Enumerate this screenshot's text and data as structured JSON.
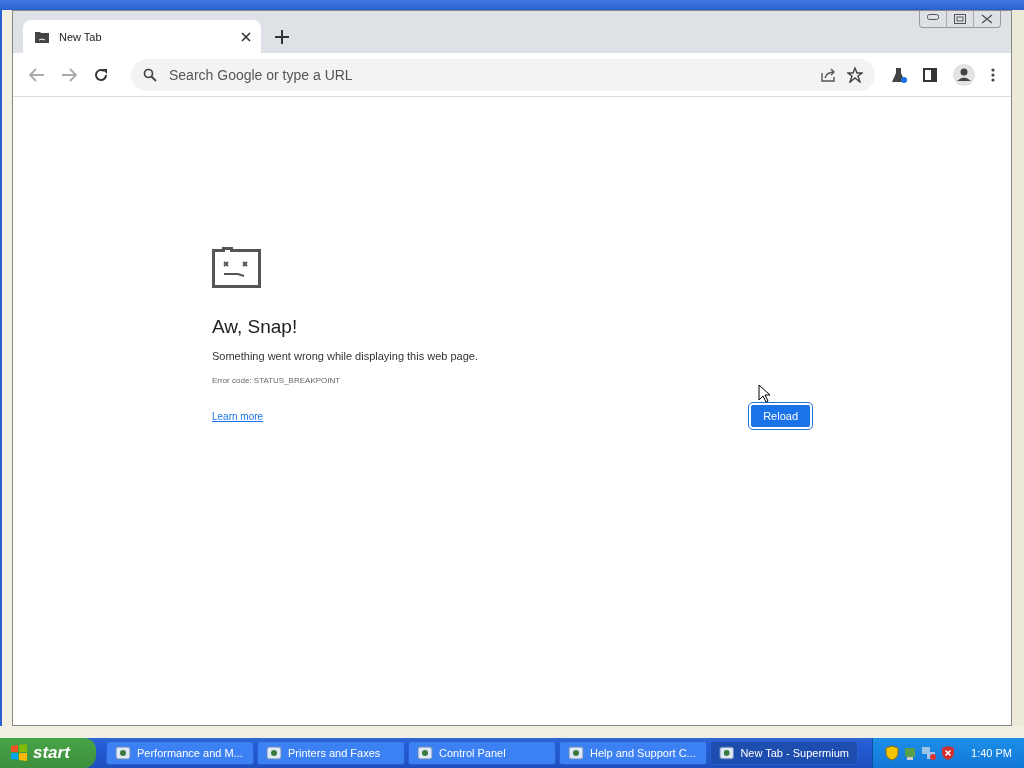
{
  "browser": {
    "tabs": [
      {
        "title": "New Tab",
        "selected": true
      }
    ],
    "address_bar": {
      "placeholder": "Search Google or type a URL"
    }
  },
  "error_page": {
    "heading": "Aw, Snap!",
    "message": "Something went wrong while displaying this web page.",
    "error_code": "Error code: STATUS_BREAKPOINT",
    "link": "Learn more",
    "button": "Reload"
  },
  "taskbar": {
    "start": "start",
    "tasks": [
      {
        "label": "Performance and M...",
        "selected": false
      },
      {
        "label": "Printers and Faxes",
        "selected": false
      },
      {
        "label": "Control Panel",
        "selected": false
      },
      {
        "label": "Help and Support C...",
        "selected": false
      },
      {
        "label": "New Tab - Supermium",
        "selected": true
      }
    ],
    "clock": "1:40 PM"
  }
}
